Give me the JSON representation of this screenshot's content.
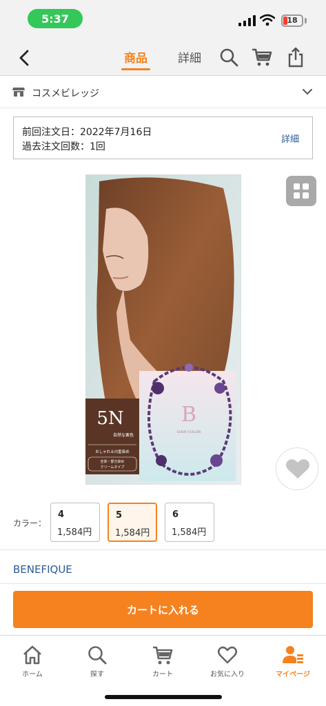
{
  "status": {
    "time": "5:37",
    "battery": "18"
  },
  "header": {
    "tabs": [
      {
        "label": "商品",
        "active": true
      },
      {
        "label": "詳細",
        "active": false
      }
    ],
    "icons": [
      "back-arrow-icon",
      "search-icon",
      "cart-icon",
      "share-icon"
    ]
  },
  "shop": {
    "name": "コスメビレッジ",
    "icon": "store-icon"
  },
  "order_info": {
    "last_order": "前回注文日：2022年7月16日",
    "order_count": "過去注文回数：1回",
    "detail_link": "詳細"
  },
  "product": {
    "package_shade": "5N",
    "package_shade_desc": "自然な栗色",
    "package_sub": "おしゃれ＆白髪染め",
    "package_type": "全体・部分染め\nクリームタイプ",
    "package_brand_text": "HAIR COLOR"
  },
  "colors": {
    "label": "カラー：",
    "selected": "5",
    "variants": [
      {
        "num": "4",
        "price": "1,584円"
      },
      {
        "num": "5",
        "price": "1,584円"
      },
      {
        "num": "6",
        "price": "1,584円"
      }
    ]
  },
  "brand": "BENEFIQUE",
  "cart_button": "カートに入れる",
  "tabbar": [
    {
      "label": "ホーム",
      "icon": "home-icon"
    },
    {
      "label": "探す",
      "icon": "search-icon"
    },
    {
      "label": "カート",
      "icon": "cart-icon"
    },
    {
      "label": "お気に入り",
      "icon": "heart-icon"
    },
    {
      "label": "マイページ",
      "icon": "mypage-icon",
      "active": true
    }
  ],
  "colors_theme": {
    "accent": "#f5821f",
    "link": "#2a5a9a",
    "status_green": "#34c759"
  }
}
